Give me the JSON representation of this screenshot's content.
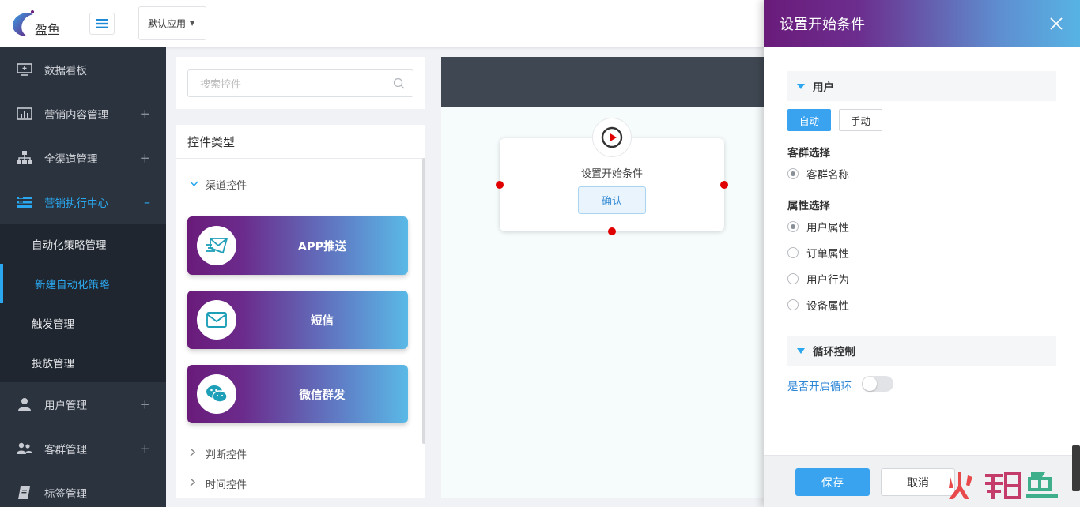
{
  "header": {
    "logo_text": "盈鱼",
    "app_select": "默认应用"
  },
  "sidebar": {
    "items": [
      {
        "label": "数据看板",
        "icon": "monitor-icon",
        "expander": ""
      },
      {
        "label": "营销内容管理",
        "icon": "bar-chart-icon",
        "expander": "+"
      },
      {
        "label": "全渠道管理",
        "icon": "org-chart-icon",
        "expander": "+"
      },
      {
        "label": "营销执行中心",
        "icon": "list-icon",
        "expander": "–"
      }
    ],
    "submenu": [
      {
        "label": "自动化策略管理"
      },
      {
        "label": "新建自动化策略"
      },
      {
        "label": "触发管理"
      },
      {
        "label": "投放管理"
      }
    ],
    "items_after": [
      {
        "label": "用户管理",
        "icon": "user-icon",
        "expander": "+"
      },
      {
        "label": "客群管理",
        "icon": "users-icon",
        "expander": "+"
      },
      {
        "label": "标签管理",
        "icon": "tag-icon",
        "expander": ""
      }
    ]
  },
  "controls": {
    "search_placeholder": "搜索控件",
    "title": "控件类型",
    "group_channel": "渠道控件",
    "cards": [
      {
        "label": "APP推送",
        "icon": "send-mail-icon"
      },
      {
        "label": "短信",
        "icon": "envelope-icon"
      },
      {
        "label": "微信群发",
        "icon": "wechat-icon"
      }
    ],
    "group_judge": "判断控件",
    "group_time": "时间控件"
  },
  "canvas": {
    "node_title": "设置开始条件",
    "node_confirm": "确认"
  },
  "drawer": {
    "title": "设置开始条件",
    "section_user": "用户",
    "mode_auto": "自动",
    "mode_manual": "手动",
    "group_label": "客群选择",
    "group_option": "客群名称",
    "attr_label": "属性选择",
    "attr_options": [
      "用户属性",
      "订单属性",
      "用户行为",
      "设备属性"
    ],
    "section_loop": "循环控制",
    "loop_label": "是否开启循环",
    "loop_enabled": false,
    "save": "保存",
    "cancel": "取消"
  },
  "colors": {
    "accent": "#2aa7ee",
    "primary_button": "#3aa3f0",
    "sidebar_bg": "#2b333e",
    "gradient_start": "#6a1b7a",
    "gradient_end": "#57b3e4",
    "port": "#e00000"
  }
}
